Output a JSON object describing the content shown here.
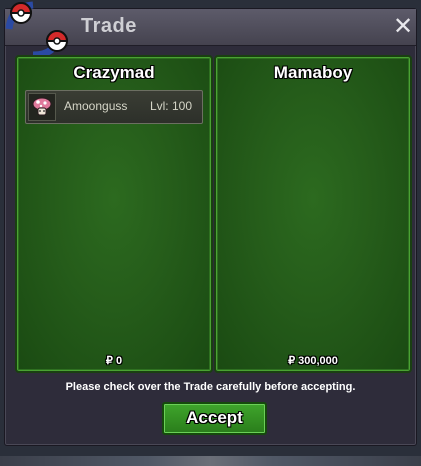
{
  "window": {
    "title": "Trade",
    "close_label": "✕"
  },
  "trade": {
    "left": {
      "player": "Crazymad",
      "items": [
        {
          "name": "Amoonguss",
          "level": "Lvl: 100"
        }
      ],
      "money": "₽ 0"
    },
    "right": {
      "player": "Mamaboy",
      "items": [],
      "money": "₽ 300,000"
    }
  },
  "footer": {
    "notice": "Please check over the Trade carefully before accepting.",
    "accept_label": "Accept"
  },
  "colors": {
    "panel_green": "#255c1a",
    "button_green": "#3fa52c",
    "window_bg": "#2e2c3a"
  }
}
